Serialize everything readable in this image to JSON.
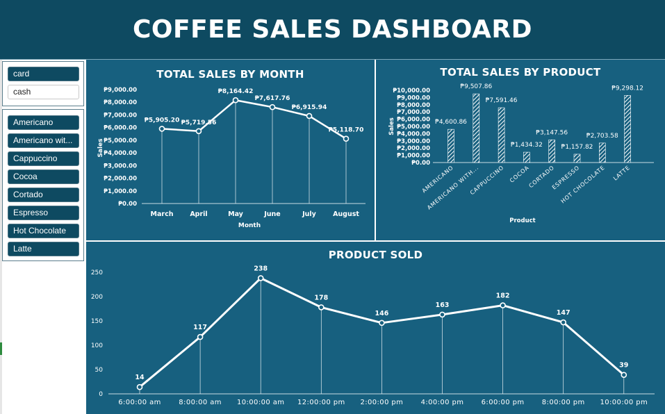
{
  "dashboard": {
    "title": "COFFEE SALES DASHBOARD"
  },
  "slicer_payment": {
    "items": [
      {
        "label": "card",
        "selected": true
      },
      {
        "label": "cash",
        "selected": false
      }
    ]
  },
  "slicer_product": {
    "items": [
      {
        "label": "Americano"
      },
      {
        "label": "Americano wit..."
      },
      {
        "label": "Cappuccino"
      },
      {
        "label": "Cocoa"
      },
      {
        "label": "Cortado"
      },
      {
        "label": "Espresso"
      },
      {
        "label": "Hot Chocolate"
      },
      {
        "label": "Latte"
      }
    ]
  },
  "colors": {
    "header": "#0e4a61",
    "panel": "#17607f",
    "line": "#ffffff"
  },
  "chart_data": [
    {
      "type": "line",
      "title": "TOTAL SALES BY MONTH",
      "xlabel": "Month",
      "ylabel": "Sales",
      "categories": [
        "March",
        "April",
        "May",
        "June",
        "July",
        "August"
      ],
      "values": [
        5905.2,
        5719.56,
        8164.42,
        7617.76,
        6915.94,
        5118.7
      ],
      "data_labels": [
        "₱5,905.20",
        "₱5,719.56",
        "₱8,164.42",
        "₱7,617.76",
        "₱6,915.94",
        "₱5,118.70"
      ],
      "ylim": [
        0,
        9000
      ],
      "yticks": [
        "₱0.00",
        "₱1,000.00",
        "₱2,000.00",
        "₱3,000.00",
        "₱4,000.00",
        "₱5,000.00",
        "₱6,000.00",
        "₱7,000.00",
        "₱8,000.00",
        "₱9,000.00"
      ],
      "grid": false,
      "legend": "none"
    },
    {
      "type": "bar",
      "title": "TOTAL SALES BY PRODUCT",
      "xlabel": "Product",
      "ylabel": "Sales",
      "categories": [
        "AMERICANO",
        "AMERICANO WITH...",
        "CAPPUCCINO",
        "COCOA",
        "CORTADO",
        "ESPRESSO",
        "HOT CHOCOLATE",
        "LATTE"
      ],
      "values": [
        4600.86,
        9507.86,
        7591.46,
        1434.32,
        3147.56,
        1157.82,
        2703.58,
        9298.12
      ],
      "data_labels": [
        "₱4,600.86",
        "₱9,507.86",
        "₱7,591.46",
        "₱1,434.32",
        "₱3,147.56",
        "₱1,157.82",
        "₱2,703.58",
        "₱9,298.12"
      ],
      "ylim": [
        0,
        10000
      ],
      "yticks": [
        "₱0.00",
        "₱1,000.00",
        "₱2,000.00",
        "₱3,000.00",
        "₱4,000.00",
        "₱5,000.00",
        "₱6,000.00",
        "₱7,000.00",
        "₱8,000.00",
        "₱9,000.00",
        "₱10,000.00"
      ],
      "grid": false,
      "legend": "none"
    },
    {
      "type": "line",
      "title": "PRODUCT SOLD",
      "xlabel": "",
      "ylabel": "",
      "categories": [
        "6:00:00 am",
        "8:00:00 am",
        "10:00:00 am",
        "12:00:00 pm",
        "2:00:00 pm",
        "4:00:00 pm",
        "6:00:00 pm",
        "8:00:00 pm",
        "10:00:00 pm"
      ],
      "values": [
        14,
        117,
        238,
        178,
        146,
        163,
        182,
        147,
        39
      ],
      "data_labels": [
        "14",
        "117",
        "238",
        "178",
        "146",
        "163",
        "182",
        "147",
        "39"
      ],
      "ylim": [
        0,
        250
      ],
      "yticks": [
        "0",
        "50",
        "100",
        "150",
        "200",
        "250"
      ],
      "grid": false,
      "legend": "none"
    }
  ]
}
